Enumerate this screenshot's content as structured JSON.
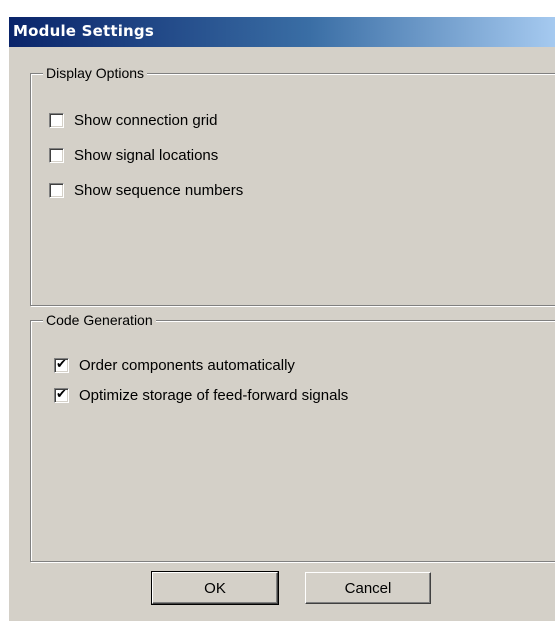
{
  "window": {
    "title": "Module Settings"
  },
  "display_options": {
    "legend": "Display Options",
    "items": [
      {
        "label": "Show connection grid",
        "checked": false
      },
      {
        "label": "Show signal locations",
        "checked": false
      },
      {
        "label": "Show sequence numbers",
        "checked": false
      }
    ]
  },
  "code_generation": {
    "legend": "Code Generation",
    "items": [
      {
        "label": "Order components automatically",
        "checked": true,
        "mark": "✔"
      },
      {
        "label": "Optimize storage of feed-forward signals",
        "checked": true,
        "mark": "✔"
      }
    ]
  },
  "buttons": {
    "ok_label": "OK",
    "cancel_label": "Cancel"
  },
  "colors": {
    "dialog_face": "#d4d0c8",
    "title_gradient_start": "#0a246a",
    "title_gradient_end": "#a6caf0",
    "title_text": "#ffffff"
  }
}
